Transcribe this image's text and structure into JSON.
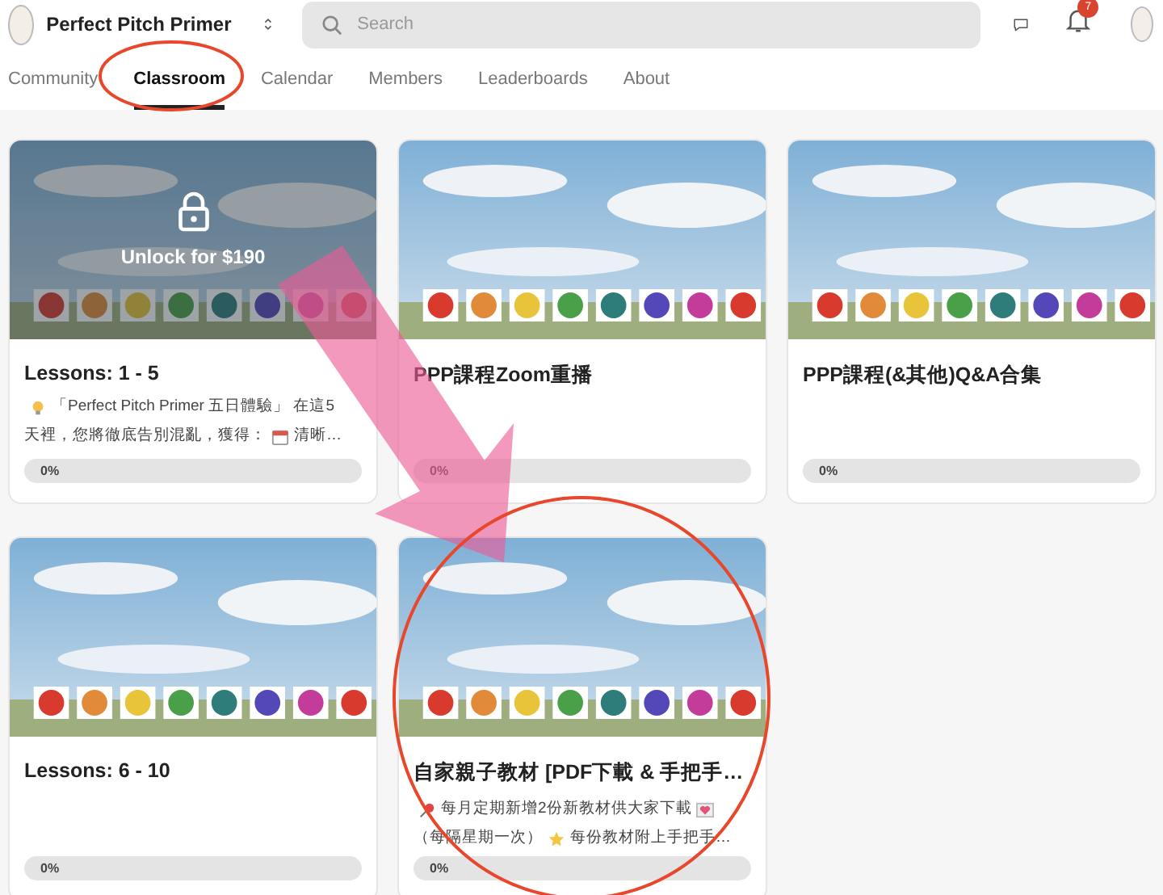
{
  "header": {
    "community_name": "Perfect Pitch Primer",
    "search": {
      "placeholder": "Search"
    },
    "notifications_badge": "7"
  },
  "tabs": [
    {
      "label": "Community",
      "selected": false
    },
    {
      "label": "Classroom",
      "selected": true
    },
    {
      "label": "Calendar",
      "selected": false
    },
    {
      "label": "Members",
      "selected": false
    },
    {
      "label": "Leaderboards",
      "selected": false
    },
    {
      "label": "About",
      "selected": false
    }
  ],
  "courses": [
    {
      "title": "Lessons: 1 - 5",
      "locked": true,
      "unlock_label": "Unlock for $190",
      "description_lines": [
        [
          {
            "kind": "bulb"
          },
          {
            "kind": "text",
            "text": "「Perfect Pitch Primer 五日體驗」 在這5"
          }
        ],
        [
          {
            "kind": "text",
            "text": "天裡，您將徹底告別混亂，獲得："
          },
          {
            "kind": "calendar"
          },
          {
            "kind": "text",
            "text": "清晰…"
          }
        ]
      ],
      "progress": {
        "level": 0,
        "label": "0%"
      }
    },
    {
      "title": "PPP課程Zoom重播",
      "locked": false,
      "progress": {
        "level": 0,
        "label": "0%"
      }
    },
    {
      "title": "PPP課程(&其他)Q&A合集",
      "locked": false,
      "progress": {
        "level": 0,
        "label": "0%"
      }
    },
    {
      "title": "Lessons: 6 - 10",
      "locked": false,
      "progress": {
        "level": 0,
        "label": "0%"
      }
    },
    {
      "title": "自家親子教材 [PDF下載 & 手把手…",
      "locked": false,
      "description_lines": [
        [
          {
            "kind": "pin"
          },
          {
            "kind": "text",
            "text": "每月定期新增2份新教材供大家下載"
          },
          {
            "kind": "heart"
          }
        ],
        [
          {
            "kind": "text",
            "text": "（每隔星期一次）"
          },
          {
            "kind": "star"
          },
          {
            "kind": "text",
            "text": "每份教材附上手把手…"
          }
        ]
      ],
      "progress": {
        "level": 0,
        "label": "0%"
      }
    }
  ]
}
